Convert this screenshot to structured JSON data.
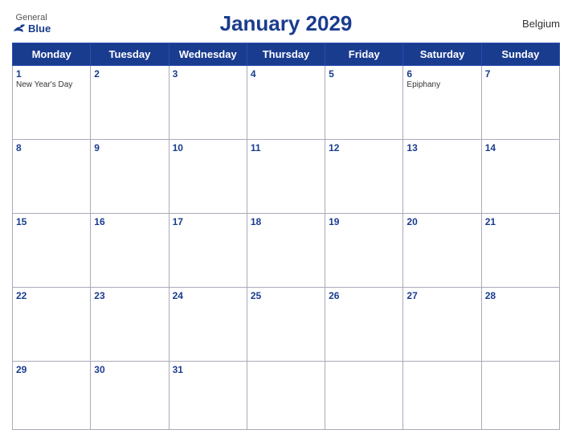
{
  "header": {
    "title": "January 2029",
    "country": "Belgium",
    "logo": {
      "general": "General",
      "blue": "Blue"
    }
  },
  "days_of_week": [
    "Monday",
    "Tuesday",
    "Wednesday",
    "Thursday",
    "Friday",
    "Saturday",
    "Sunday"
  ],
  "weeks": [
    [
      {
        "day": 1,
        "holiday": "New Year's Day"
      },
      {
        "day": 2,
        "holiday": null
      },
      {
        "day": 3,
        "holiday": null
      },
      {
        "day": 4,
        "holiday": null
      },
      {
        "day": 5,
        "holiday": null
      },
      {
        "day": 6,
        "holiday": "Epiphany"
      },
      {
        "day": 7,
        "holiday": null
      }
    ],
    [
      {
        "day": 8,
        "holiday": null
      },
      {
        "day": 9,
        "holiday": null
      },
      {
        "day": 10,
        "holiday": null
      },
      {
        "day": 11,
        "holiday": null
      },
      {
        "day": 12,
        "holiday": null
      },
      {
        "day": 13,
        "holiday": null
      },
      {
        "day": 14,
        "holiday": null
      }
    ],
    [
      {
        "day": 15,
        "holiday": null
      },
      {
        "day": 16,
        "holiday": null
      },
      {
        "day": 17,
        "holiday": null
      },
      {
        "day": 18,
        "holiday": null
      },
      {
        "day": 19,
        "holiday": null
      },
      {
        "day": 20,
        "holiday": null
      },
      {
        "day": 21,
        "holiday": null
      }
    ],
    [
      {
        "day": 22,
        "holiday": null
      },
      {
        "day": 23,
        "holiday": null
      },
      {
        "day": 24,
        "holiday": null
      },
      {
        "day": 25,
        "holiday": null
      },
      {
        "day": 26,
        "holiday": null
      },
      {
        "day": 27,
        "holiday": null
      },
      {
        "day": 28,
        "holiday": null
      }
    ],
    [
      {
        "day": 29,
        "holiday": null
      },
      {
        "day": 30,
        "holiday": null
      },
      {
        "day": 31,
        "holiday": null
      },
      null,
      null,
      null,
      null
    ]
  ]
}
